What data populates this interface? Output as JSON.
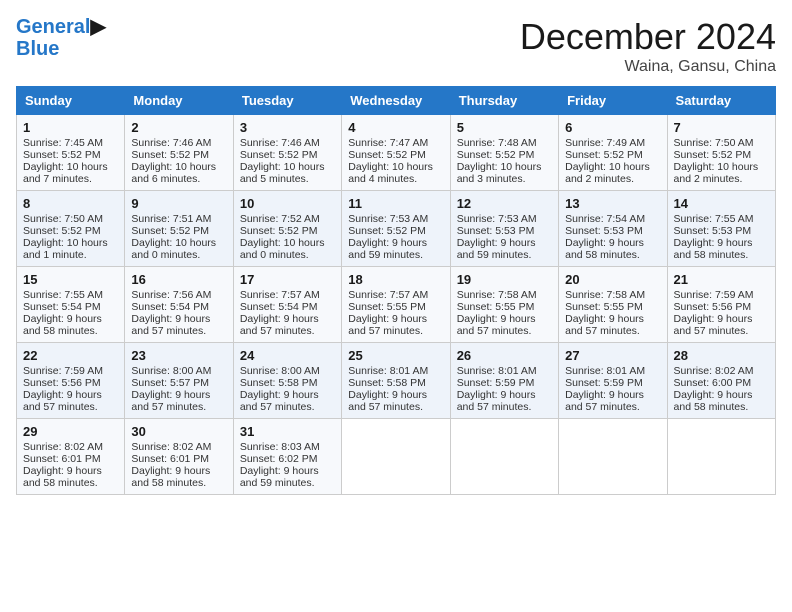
{
  "header": {
    "logo_line1": "General",
    "logo_line2": "Blue",
    "month_title": "December 2024",
    "location": "Waina, Gansu, China"
  },
  "days_of_week": [
    "Sunday",
    "Monday",
    "Tuesday",
    "Wednesday",
    "Thursday",
    "Friday",
    "Saturday"
  ],
  "weeks": [
    [
      {
        "day": "1",
        "sunrise": "Sunrise: 7:45 AM",
        "sunset": "Sunset: 5:52 PM",
        "daylight": "Daylight: 10 hours and 7 minutes."
      },
      {
        "day": "2",
        "sunrise": "Sunrise: 7:46 AM",
        "sunset": "Sunset: 5:52 PM",
        "daylight": "Daylight: 10 hours and 6 minutes."
      },
      {
        "day": "3",
        "sunrise": "Sunrise: 7:46 AM",
        "sunset": "Sunset: 5:52 PM",
        "daylight": "Daylight: 10 hours and 5 minutes."
      },
      {
        "day": "4",
        "sunrise": "Sunrise: 7:47 AM",
        "sunset": "Sunset: 5:52 PM",
        "daylight": "Daylight: 10 hours and 4 minutes."
      },
      {
        "day": "5",
        "sunrise": "Sunrise: 7:48 AM",
        "sunset": "Sunset: 5:52 PM",
        "daylight": "Daylight: 10 hours and 3 minutes."
      },
      {
        "day": "6",
        "sunrise": "Sunrise: 7:49 AM",
        "sunset": "Sunset: 5:52 PM",
        "daylight": "Daylight: 10 hours and 2 minutes."
      },
      {
        "day": "7",
        "sunrise": "Sunrise: 7:50 AM",
        "sunset": "Sunset: 5:52 PM",
        "daylight": "Daylight: 10 hours and 2 minutes."
      }
    ],
    [
      {
        "day": "8",
        "sunrise": "Sunrise: 7:50 AM",
        "sunset": "Sunset: 5:52 PM",
        "daylight": "Daylight: 10 hours and 1 minute."
      },
      {
        "day": "9",
        "sunrise": "Sunrise: 7:51 AM",
        "sunset": "Sunset: 5:52 PM",
        "daylight": "Daylight: 10 hours and 0 minutes."
      },
      {
        "day": "10",
        "sunrise": "Sunrise: 7:52 AM",
        "sunset": "Sunset: 5:52 PM",
        "daylight": "Daylight: 10 hours and 0 minutes."
      },
      {
        "day": "11",
        "sunrise": "Sunrise: 7:53 AM",
        "sunset": "Sunset: 5:52 PM",
        "daylight": "Daylight: 9 hours and 59 minutes."
      },
      {
        "day": "12",
        "sunrise": "Sunrise: 7:53 AM",
        "sunset": "Sunset: 5:53 PM",
        "daylight": "Daylight: 9 hours and 59 minutes."
      },
      {
        "day": "13",
        "sunrise": "Sunrise: 7:54 AM",
        "sunset": "Sunset: 5:53 PM",
        "daylight": "Daylight: 9 hours and 58 minutes."
      },
      {
        "day": "14",
        "sunrise": "Sunrise: 7:55 AM",
        "sunset": "Sunset: 5:53 PM",
        "daylight": "Daylight: 9 hours and 58 minutes."
      }
    ],
    [
      {
        "day": "15",
        "sunrise": "Sunrise: 7:55 AM",
        "sunset": "Sunset: 5:54 PM",
        "daylight": "Daylight: 9 hours and 58 minutes."
      },
      {
        "day": "16",
        "sunrise": "Sunrise: 7:56 AM",
        "sunset": "Sunset: 5:54 PM",
        "daylight": "Daylight: 9 hours and 57 minutes."
      },
      {
        "day": "17",
        "sunrise": "Sunrise: 7:57 AM",
        "sunset": "Sunset: 5:54 PM",
        "daylight": "Daylight: 9 hours and 57 minutes."
      },
      {
        "day": "18",
        "sunrise": "Sunrise: 7:57 AM",
        "sunset": "Sunset: 5:55 PM",
        "daylight": "Daylight: 9 hours and 57 minutes."
      },
      {
        "day": "19",
        "sunrise": "Sunrise: 7:58 AM",
        "sunset": "Sunset: 5:55 PM",
        "daylight": "Daylight: 9 hours and 57 minutes."
      },
      {
        "day": "20",
        "sunrise": "Sunrise: 7:58 AM",
        "sunset": "Sunset: 5:55 PM",
        "daylight": "Daylight: 9 hours and 57 minutes."
      },
      {
        "day": "21",
        "sunrise": "Sunrise: 7:59 AM",
        "sunset": "Sunset: 5:56 PM",
        "daylight": "Daylight: 9 hours and 57 minutes."
      }
    ],
    [
      {
        "day": "22",
        "sunrise": "Sunrise: 7:59 AM",
        "sunset": "Sunset: 5:56 PM",
        "daylight": "Daylight: 9 hours and 57 minutes."
      },
      {
        "day": "23",
        "sunrise": "Sunrise: 8:00 AM",
        "sunset": "Sunset: 5:57 PM",
        "daylight": "Daylight: 9 hours and 57 minutes."
      },
      {
        "day": "24",
        "sunrise": "Sunrise: 8:00 AM",
        "sunset": "Sunset: 5:58 PM",
        "daylight": "Daylight: 9 hours and 57 minutes."
      },
      {
        "day": "25",
        "sunrise": "Sunrise: 8:01 AM",
        "sunset": "Sunset: 5:58 PM",
        "daylight": "Daylight: 9 hours and 57 minutes."
      },
      {
        "day": "26",
        "sunrise": "Sunrise: 8:01 AM",
        "sunset": "Sunset: 5:59 PM",
        "daylight": "Daylight: 9 hours and 57 minutes."
      },
      {
        "day": "27",
        "sunrise": "Sunrise: 8:01 AM",
        "sunset": "Sunset: 5:59 PM",
        "daylight": "Daylight: 9 hours and 57 minutes."
      },
      {
        "day": "28",
        "sunrise": "Sunrise: 8:02 AM",
        "sunset": "Sunset: 6:00 PM",
        "daylight": "Daylight: 9 hours and 58 minutes."
      }
    ],
    [
      {
        "day": "29",
        "sunrise": "Sunrise: 8:02 AM",
        "sunset": "Sunset: 6:01 PM",
        "daylight": "Daylight: 9 hours and 58 minutes."
      },
      {
        "day": "30",
        "sunrise": "Sunrise: 8:02 AM",
        "sunset": "Sunset: 6:01 PM",
        "daylight": "Daylight: 9 hours and 58 minutes."
      },
      {
        "day": "31",
        "sunrise": "Sunrise: 8:03 AM",
        "sunset": "Sunset: 6:02 PM",
        "daylight": "Daylight: 9 hours and 59 minutes."
      },
      null,
      null,
      null,
      null
    ]
  ]
}
